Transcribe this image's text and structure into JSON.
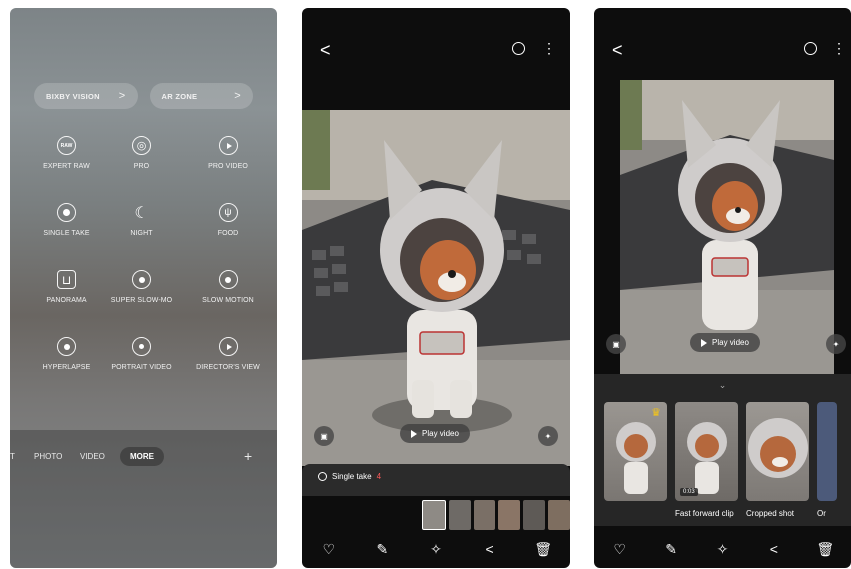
{
  "phone1": {
    "chips": [
      {
        "label": "BIXBY VISION",
        "chevron": ">"
      },
      {
        "label": "AR ZONE",
        "chevron": ">"
      }
    ],
    "modes": [
      {
        "label": "EXPERT RAW",
        "icon": "raw-icon",
        "glyph": "RAW"
      },
      {
        "label": "PRO",
        "icon": "aperture-icon",
        "glyph": "◎"
      },
      {
        "label": "PRO VIDEO",
        "icon": "pro-video-icon",
        "glyph": ""
      },
      {
        "label": "SINGLE TAKE",
        "icon": "single-take-icon",
        "glyph": ""
      },
      {
        "label": "NIGHT",
        "icon": "moon-icon",
        "glyph": "☾"
      },
      {
        "label": "FOOD",
        "icon": "food-icon",
        "glyph": "ψ"
      },
      {
        "label": "PANORAMA",
        "icon": "panorama-icon",
        "glyph": "⊔"
      },
      {
        "label": "SUPER SLOW-MO",
        "icon": "super-slow-mo-icon",
        "glyph": ""
      },
      {
        "label": "SLOW MOTION",
        "icon": "slow-motion-icon",
        "glyph": ""
      },
      {
        "label": "HYPERLAPSE",
        "icon": "hyperlapse-icon",
        "glyph": ""
      },
      {
        "label": "PORTRAIT VIDEO",
        "icon": "portrait-video-icon",
        "glyph": ""
      },
      {
        "label": "DIRECTOR'S VIEW",
        "icon": "directors-view-icon",
        "glyph": ""
      }
    ],
    "mode_bar": {
      "partial": "T",
      "photo": "PHOTO",
      "video": "VIDEO",
      "more": "MORE",
      "add": "+"
    }
  },
  "phone2": {
    "back": "<",
    "play_label": "Play video",
    "single_take_label": "Single take",
    "single_take_count": "4",
    "actions": [
      "heart-icon",
      "pencil-icon",
      "magic-icon",
      "share-icon",
      "trash-icon"
    ]
  },
  "phone3": {
    "back": "<",
    "play_label": "Play video",
    "grip": "⌄",
    "cards": [
      {
        "caption": "",
        "badge": "crown-icon",
        "duration": ""
      },
      {
        "caption": "Fast forward clip",
        "badge": "",
        "duration": "0:03"
      },
      {
        "caption": "Cropped shot",
        "badge": "",
        "duration": ""
      },
      {
        "caption": "Or",
        "badge": "",
        "duration": ""
      }
    ],
    "actions": [
      "heart-icon",
      "pencil-icon",
      "magic-icon",
      "share-icon",
      "trash-icon"
    ]
  },
  "colors": {
    "single_take_count": "#ff5a5a",
    "crown": "#f5c518",
    "sheet": "#262626"
  }
}
